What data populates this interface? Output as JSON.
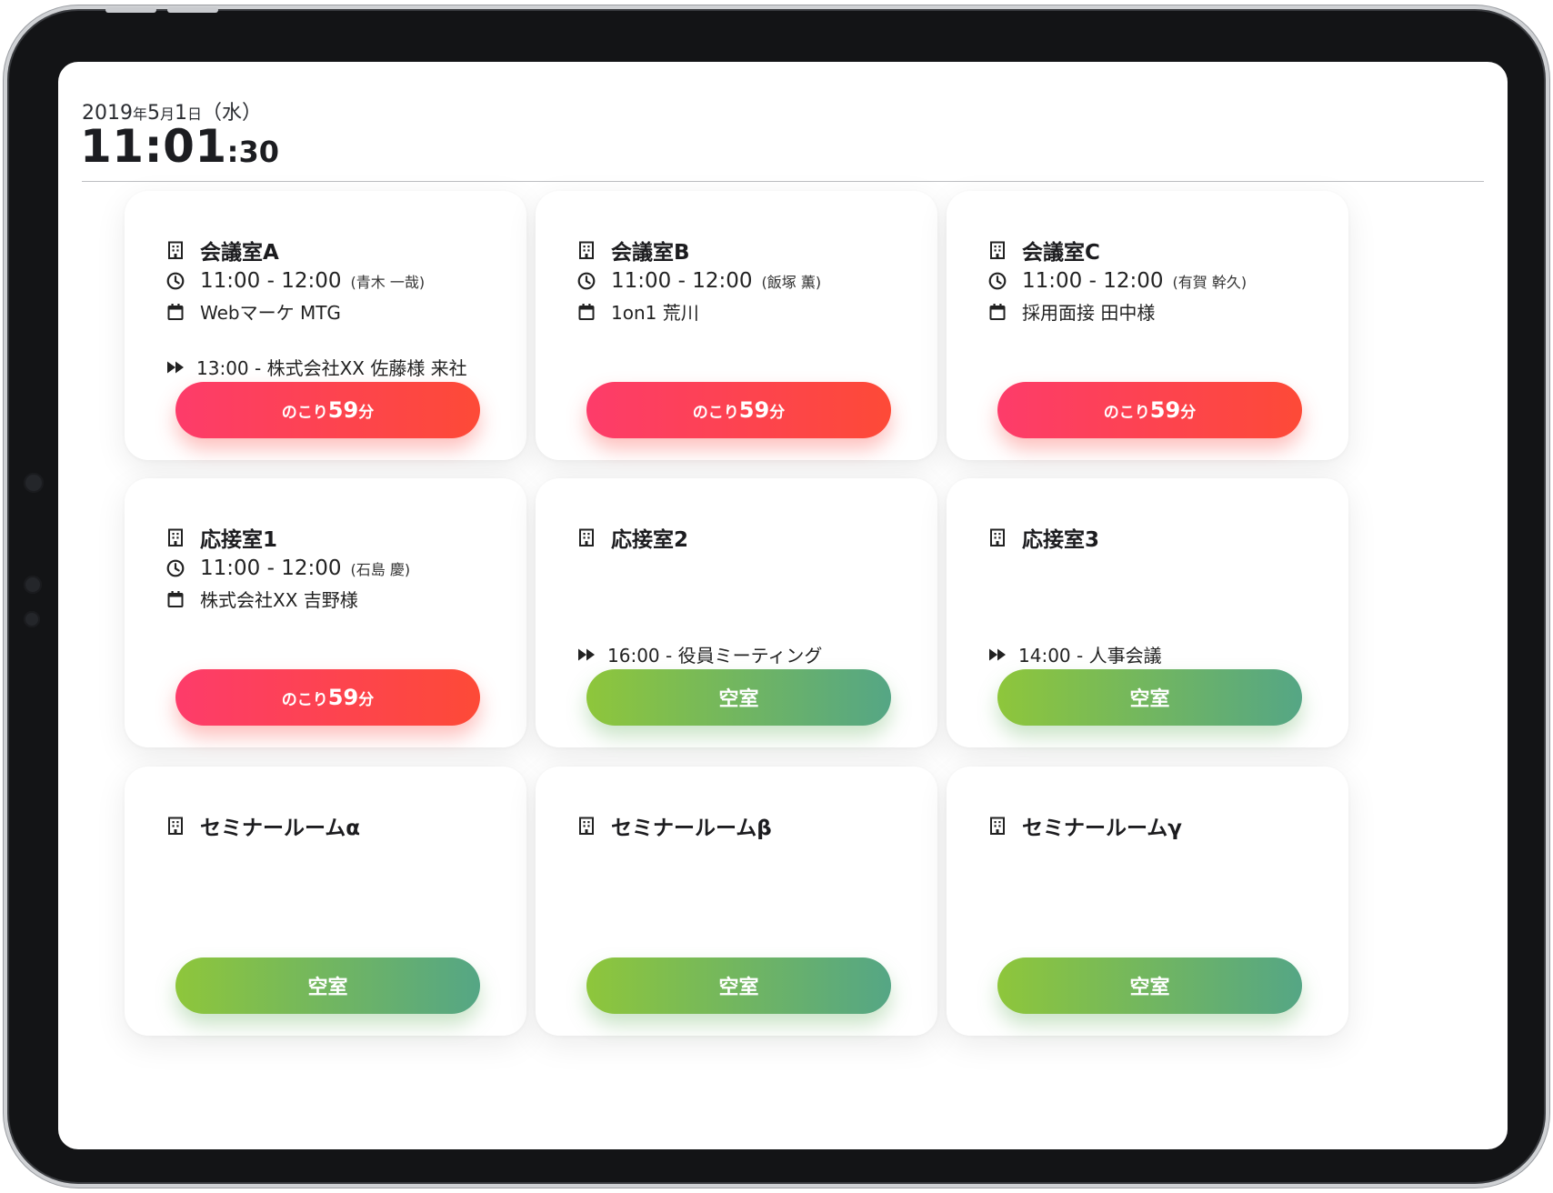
{
  "header": {
    "date": {
      "year": "2019",
      "y": "年",
      "month": "5",
      "m": "月",
      "day": "1",
      "d": "日",
      "weekday": "（水）"
    },
    "time": {
      "hm": "11:01",
      "sec": ":30"
    }
  },
  "rooms": [
    {
      "name": "会議室A",
      "meeting": {
        "time": "11:00 - 12:00",
        "who": "(青木 一哉)",
        "title": "Webマーケ MTG"
      },
      "next": "13:00 - 株式会社XX 佐藤様 来社",
      "status": {
        "prefix": "のこり",
        "number": "59",
        "suffix": "分"
      }
    },
    {
      "name": "会議室B",
      "meeting": {
        "time": "11:00 - 12:00",
        "who": "(飯塚 薫)",
        "title": "1on1 荒川"
      },
      "next": "",
      "status": {
        "prefix": "のこり",
        "number": "59",
        "suffix": "分"
      }
    },
    {
      "name": "会議室C",
      "meeting": {
        "time": "11:00 - 12:00",
        "who": "(有賀 幹久)",
        "title": "採用面接 田中様"
      },
      "next": "",
      "status": {
        "prefix": "のこり",
        "number": "59",
        "suffix": "分"
      }
    },
    {
      "name": "応接室1",
      "meeting": {
        "time": "11:00 - 12:00",
        "who": "(石島 慶)",
        "title": "株式会社XX 吉野様"
      },
      "next": "",
      "status": {
        "prefix": "のこり",
        "number": "59",
        "suffix": "分"
      }
    },
    {
      "name": "応接室2",
      "meeting": null,
      "next": "16:00 - 役員ミーティング",
      "status": {
        "label": "空室"
      }
    },
    {
      "name": "応接室3",
      "meeting": null,
      "next": "14:00 - 人事会議",
      "status": {
        "label": "空室"
      }
    },
    {
      "name": "セミナールームα",
      "meeting": null,
      "next": "",
      "status": {
        "label": "空室"
      }
    },
    {
      "name": "セミナールームβ",
      "meeting": null,
      "next": "",
      "status": {
        "label": "空室"
      }
    },
    {
      "name": "セミナールームγ",
      "meeting": null,
      "next": "",
      "status": {
        "label": "空室"
      }
    }
  ],
  "icons": {
    "room": "building-icon",
    "time": "clock-icon",
    "title": "calendar-icon",
    "next": "fast-forward-icon"
  },
  "colors": {
    "busy_start": "#fd3c6a",
    "busy_end": "#fd4a37",
    "free_start": "#8ec63b",
    "free_end": "#55a685"
  }
}
